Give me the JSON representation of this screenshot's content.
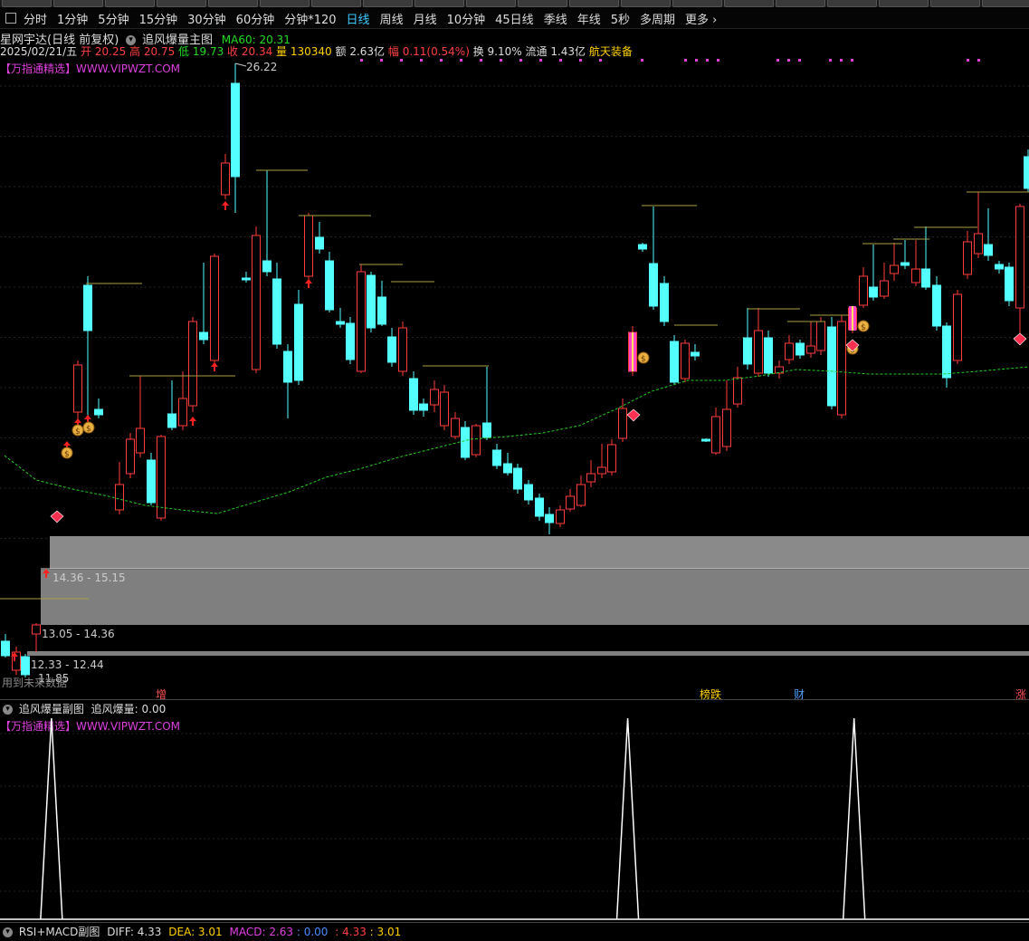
{
  "top_toolbar": {
    "count": 20
  },
  "period_bar": {
    "items": [
      "分时",
      "1分钟",
      "5分钟",
      "15分钟",
      "30分钟",
      "60分钟",
      "分钟*120",
      "日线",
      "周线",
      "月线",
      "10分钟",
      "45日线",
      "季线",
      "年线",
      "5秒",
      "多周期",
      "更多 ›"
    ],
    "active_index": 7
  },
  "main_chart": {
    "stock_name": "星网宇达(日线 前复权)",
    "indicator_name": "追风爆量主图",
    "ma60_label": "MA60: 20.31",
    "date": "2025/02/21/五",
    "open": "开 20.25",
    "high": "高 20.75",
    "low": "低 19.73",
    "close": "收 20.34",
    "volume": "量 130340",
    "amount": "额 2.63亿",
    "change": "幅 0.11(0.54%)",
    "turnover": "换 9.10%",
    "float": "流通 1.43亿",
    "sector": "航天装备",
    "watermark": "【万指通精选】WWW.VIPWZT.COM",
    "high_label": "26.22",
    "low_label": "11.85",
    "zone_labels": [
      "14.36 - 15.15",
      "13.05 - 14.36",
      "12.33 - 12.44"
    ],
    "bottom_note": "用到未来数据",
    "badges": [
      {
        "text": "增",
        "color": "#ff5050"
      },
      {
        "text": "榜跌",
        "color": "#ffd000"
      },
      {
        "text": "财",
        "color": "#4aa0ff"
      },
      {
        "text": "涨",
        "color": "#ff5050"
      }
    ],
    "colors": {
      "up": "#ff3c3c",
      "down": "#54ffff",
      "ma": "#22cc22",
      "resistance": "#a8a040"
    }
  },
  "sub_chart": {
    "title": "追风爆量副图",
    "value_label": "追风爆量: 0.00",
    "watermark": "【万指通精选】WWW.VIPWZT.COM"
  },
  "macd_bar": {
    "title": "RSI+MACD副图",
    "diff": "DIFF: 4.33",
    "dea": "DEA: 3.01",
    "macd": "MACD: 2.63",
    "v1": ": 0.00",
    "v2": ": 4.33",
    "v3": ": 3.01"
  },
  "chart_data": {
    "type": "candlestick",
    "price_range": [
      11.85,
      26.22
    ],
    "candles": [
      {
        "o": 12.25,
        "h": 12.45,
        "l": 11.95,
        "c": 12.1
      },
      {
        "o": 12.15,
        "h": 12.3,
        "l": 11.85,
        "c": 11.95
      },
      {
        "o": 12.25,
        "h": 12.8,
        "l": 11.9,
        "c": 12.6
      },
      {
        "o": 13.5,
        "h": 13.7,
        "l": 13.2,
        "c": 13.4
      },
      {
        "o": 13.9,
        "h": 14.4,
        "l": 13.8,
        "c": 14.3
      },
      {
        "o": 14.4,
        "h": 15.2,
        "l": 14.3,
        "c": 15.1
      },
      {
        "o": 15.4,
        "h": 15.6,
        "l": 14.9,
        "c": 15.5
      },
      {
        "o": 16.2,
        "h": 16.3,
        "l": 15.6,
        "c": 15.9
      },
      {
        "o": 17.6,
        "h": 17.9,
        "l": 17.3,
        "c": 17.4
      },
      {
        "o": 18.1,
        "h": 18.4,
        "l": 17.6,
        "c": 17.7
      },
      {
        "o": 18.9,
        "h": 19.3,
        "l": 18.7,
        "c": 19.1
      },
      {
        "o": 19.5,
        "h": 20.3,
        "l": 19.0,
        "c": 19.7
      },
      {
        "o": 20.2,
        "h": 20.7,
        "l": 19.7,
        "c": 20.0
      },
      {
        "o": 21.0,
        "h": 21.3,
        "l": 20.8,
        "c": 21.2
      },
      {
        "o": 21.8,
        "h": 22.1,
        "l": 21.5,
        "c": 21.7
      },
      {
        "o": 22.0,
        "h": 22.1,
        "l": 21.6,
        "c": 21.8
      },
      {
        "o": 21.7,
        "h": 22.6,
        "l": 21.6,
        "c": 22.4
      },
      {
        "o": 22.5,
        "h": 23.1,
        "l": 22.0,
        "c": 22.2
      },
      {
        "o": 22.1,
        "h": 22.6,
        "l": 21.8,
        "c": 22.4
      },
      {
        "o": 22.6,
        "h": 23.1,
        "l": 22.4,
        "c": 22.5
      },
      {
        "o": 22.8,
        "h": 23.8,
        "l": 22.5,
        "c": 23.6
      },
      {
        "o": 23.9,
        "h": 24.1,
        "l": 23.6,
        "c": 23.7
      },
      {
        "o": 23.5,
        "h": 26.22,
        "l": 23.3,
        "c": 26.0
      }
    ],
    "sub_peaks": [
      0.05,
      0.61,
      0.83
    ]
  }
}
